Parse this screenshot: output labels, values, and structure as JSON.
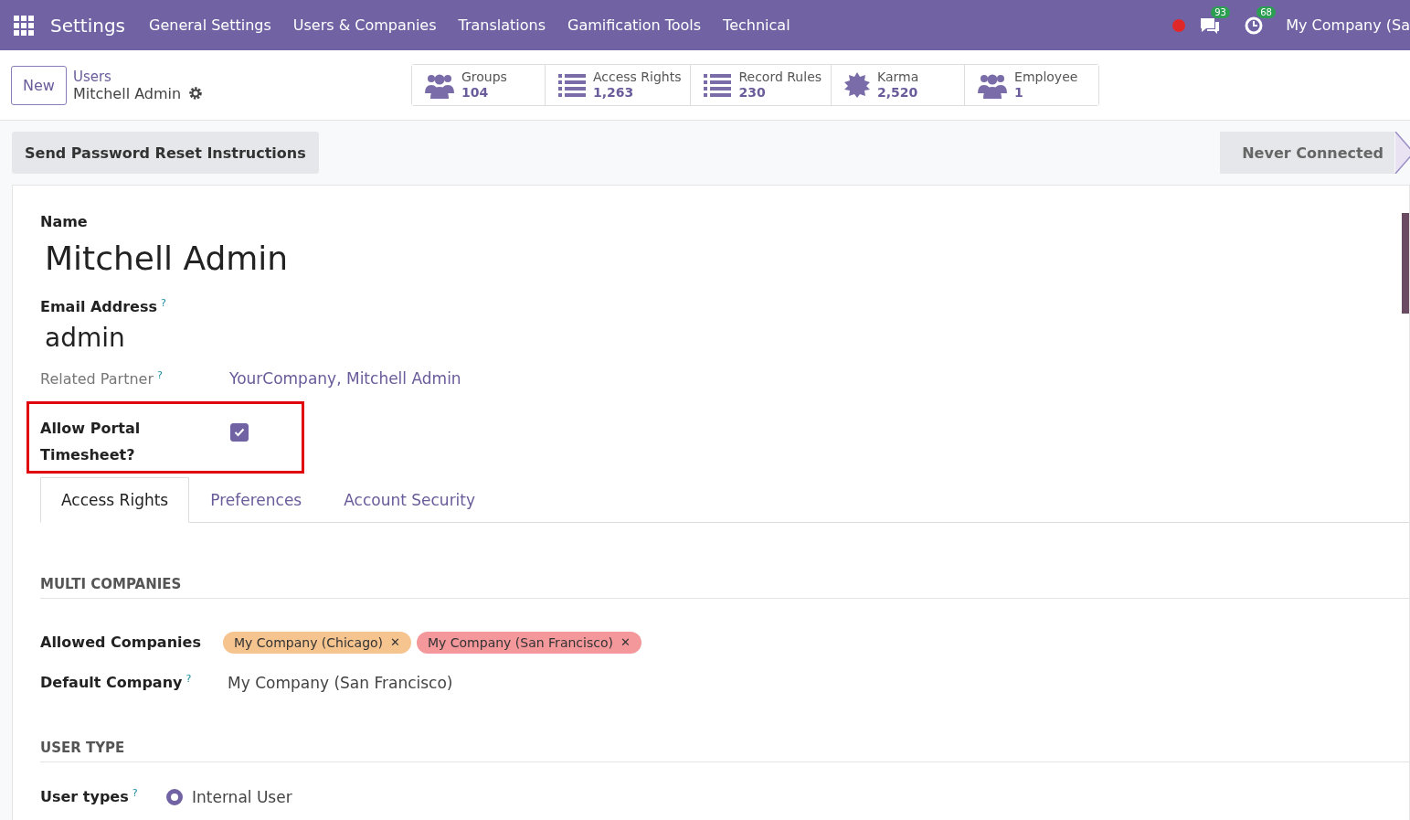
{
  "navbar": {
    "app": "Settings",
    "menus": [
      "General Settings",
      "Users & Companies",
      "Translations",
      "Gamification Tools",
      "Technical"
    ],
    "chat_count": "93",
    "activity_count": "68",
    "company": "My Company (Sa"
  },
  "control_panel": {
    "new_button": "New",
    "breadcrumb": "Users",
    "record": "Mitchell Admin",
    "stat_buttons": [
      {
        "kind": "users",
        "label": "Groups",
        "value": "104"
      },
      {
        "kind": "list",
        "label": "Access Rights",
        "value": "1,263"
      },
      {
        "kind": "list",
        "label": "Record Rules",
        "value": "230"
      },
      {
        "kind": "badge",
        "label": "Karma",
        "value": "2,520"
      },
      {
        "kind": "users",
        "label": "Employee",
        "value": "1"
      }
    ]
  },
  "status_bar": {
    "action": "Send Password Reset Instructions",
    "stages": [
      {
        "label": "Never Connected",
        "selected": false
      }
    ]
  },
  "form": {
    "name_label": "Name",
    "name": "Mitchell Admin",
    "email_label": "Email Address",
    "email_help": "?",
    "email": "admin",
    "partner_label": "Related Partner",
    "partner_help": "?",
    "partner": "YourCompany, Mitchell Admin",
    "portal_label": "Allow Portal Timesheet?",
    "portal_checked": true,
    "tabs": [
      {
        "label": "Access Rights",
        "selected": true
      },
      {
        "label": "Preferences",
        "selected": false
      },
      {
        "label": "Account Security",
        "selected": false
      }
    ],
    "sections": [
      {
        "title": "MULTI COMPANIES",
        "fields": [
          {
            "kind": "tags",
            "label": "Allowed Companies",
            "tags": [
              {
                "label": "My Company (Chicago)",
                "remove": "✕",
                "color": "#f6c48f"
              },
              {
                "label": "My Company (San Francisco)",
                "remove": "✕",
                "color": "#f4989b"
              }
            ]
          },
          {
            "kind": "text",
            "label": "Default Company",
            "help": "?",
            "value": "My Company (San Francisco)"
          }
        ]
      },
      {
        "title": "USER TYPE",
        "fields": [
          {
            "kind": "radio",
            "label": "User types",
            "help": "?",
            "options": [
              {
                "label": "Internal User",
                "selected": true
              }
            ]
          }
        ]
      }
    ]
  }
}
